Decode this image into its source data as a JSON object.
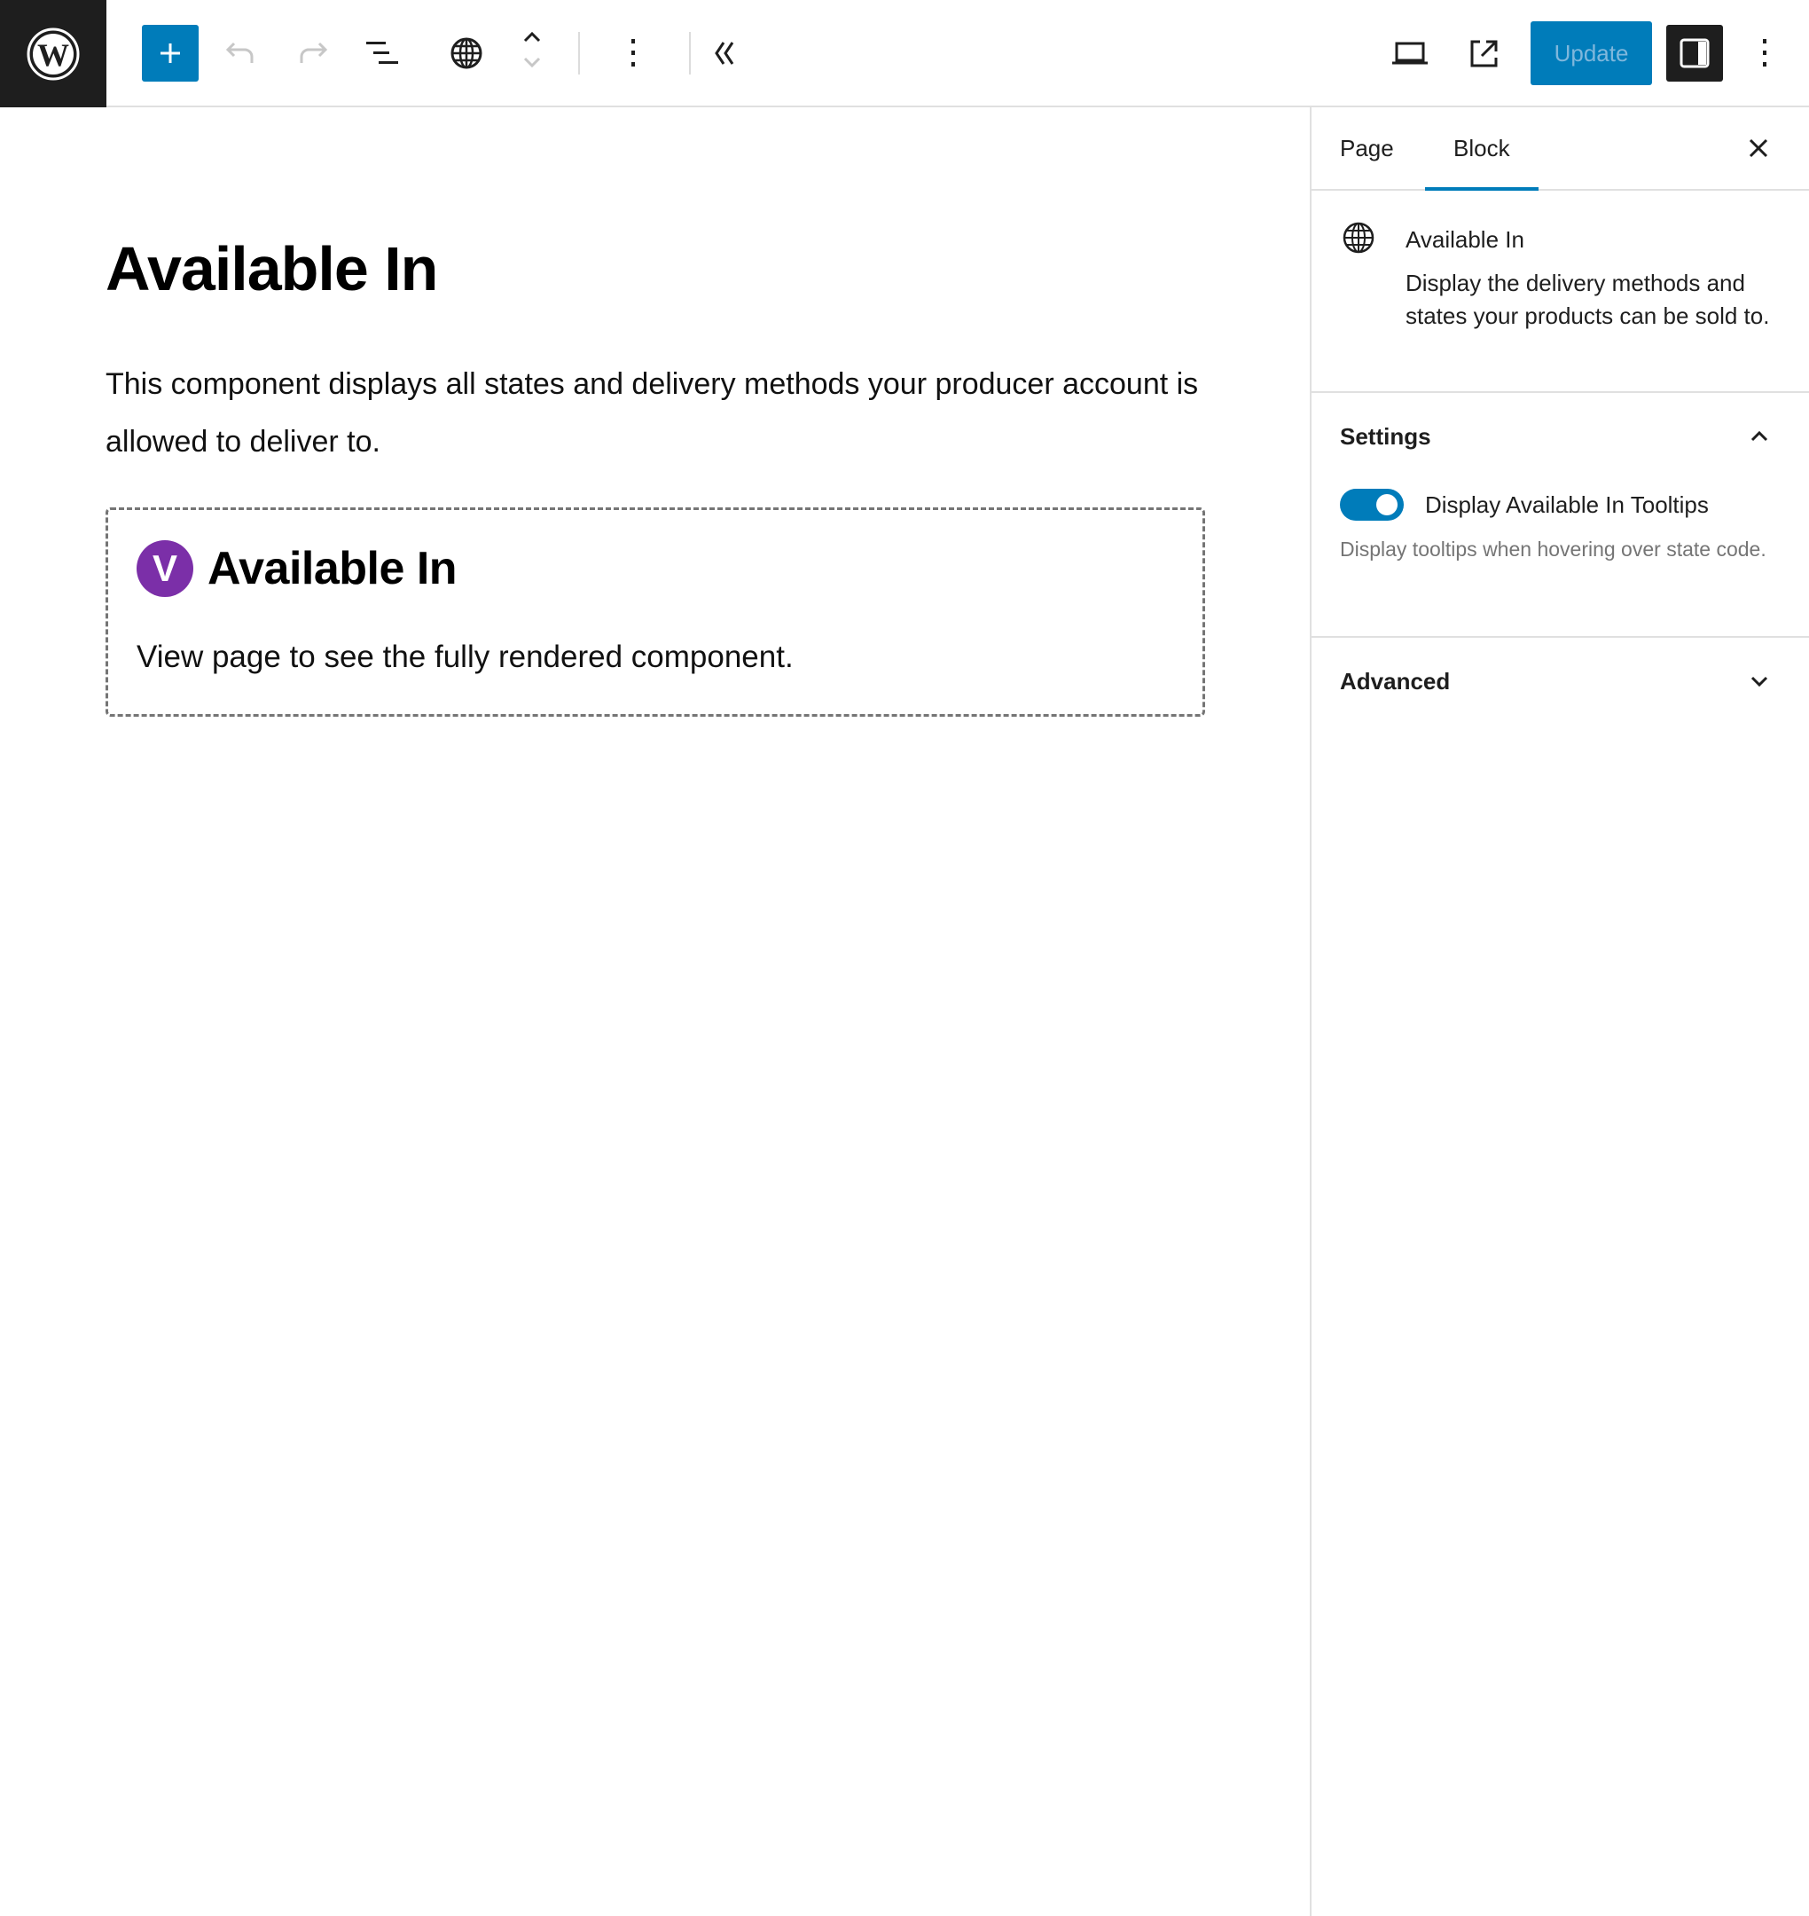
{
  "toolbar": {
    "add_block_label": "Add block",
    "update_label": "Update",
    "icons": [
      "wordpress-logo",
      "plus-icon",
      "undo-icon",
      "redo-icon",
      "list-view-icon",
      "globe-icon",
      "chevron-up-icon",
      "chevron-down-icon",
      "more-vertical-icon",
      "chevron-double-left-icon",
      "laptop-icon",
      "external-link-icon",
      "sidebar-icon",
      "more-vertical-icon"
    ]
  },
  "colors": {
    "accent": "#007cba",
    "dark": "#1e1e1e",
    "brand_purple": "#7b2fa8",
    "muted_text": "#757575"
  },
  "editor": {
    "title": "Available In",
    "paragraph": "This component displays all states and delivery methods your producer account is allowed to deliver to.",
    "block_preview": {
      "logo_letter": "V",
      "title": "Available In",
      "text": "View page to see the fully rendered component."
    }
  },
  "sidebar": {
    "tabs": [
      {
        "label": "Page",
        "active": false
      },
      {
        "label": "Block",
        "active": true
      }
    ],
    "block_card": {
      "icon": "globe-icon",
      "title": "Available In",
      "description": "Display the delivery methods and states your products can be sold to."
    },
    "panels": [
      {
        "title": "Settings",
        "expanded": true,
        "toggle": {
          "label": "Display Available In Tooltips",
          "checked": true,
          "help": "Display tooltips when hovering over state code."
        }
      },
      {
        "title": "Advanced",
        "expanded": false
      }
    ]
  }
}
